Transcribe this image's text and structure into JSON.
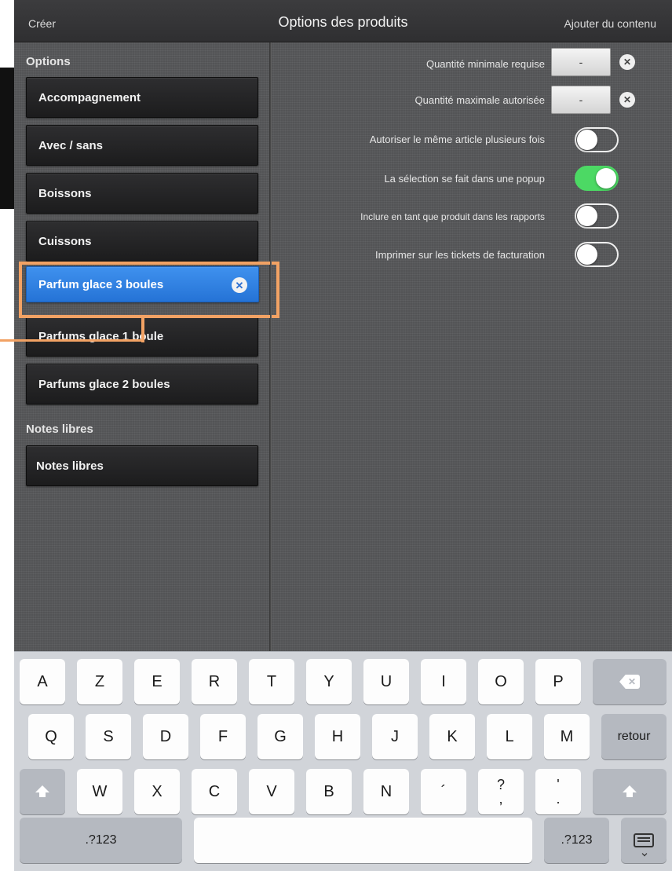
{
  "topbar": {
    "left_action": "Créer",
    "title": "Options des produits",
    "right_action": "Ajouter du contenu"
  },
  "sidebar": {
    "options_header": "Options",
    "options": [
      {
        "label": "Accompagnement",
        "selected": false
      },
      {
        "label": "Avec / sans",
        "selected": false
      },
      {
        "label": "Boissons",
        "selected": false
      },
      {
        "label": "Cuissons",
        "selected": false
      },
      {
        "label": "Parfum glace 3 boules",
        "selected": true
      },
      {
        "label": "Parfums glace 1 boule",
        "selected": false
      },
      {
        "label": "Parfums glace 2 boules",
        "selected": false
      }
    ],
    "notes_header": "Notes libres",
    "notes": [
      {
        "label": "Notes libres",
        "selected": false
      }
    ]
  },
  "settings": {
    "min_qty_label": "Quantité minimale requise",
    "min_qty_value": "-",
    "max_qty_label": "Quantité maximale autorisée",
    "max_qty_value": "-",
    "toggles": [
      {
        "label": "Autoriser le même article plusieurs fois",
        "on": false
      },
      {
        "label": "La sélection se fait dans une popup",
        "on": true
      },
      {
        "label": "Inclure en tant que produit dans les rapports",
        "on": false
      },
      {
        "label": "Imprimer sur les tickets de facturation",
        "on": false
      }
    ]
  },
  "keyboard": {
    "row1": [
      "A",
      "Z",
      "E",
      "R",
      "T",
      "Y",
      "U",
      "I",
      "O",
      "P"
    ],
    "row2": [
      "Q",
      "S",
      "D",
      "F",
      "G",
      "H",
      "J",
      "K",
      "L",
      "M"
    ],
    "return_label": "retour",
    "row3": [
      "W",
      "X",
      "C",
      "V",
      "B",
      "N"
    ],
    "punct1": "´",
    "punct2_top": "?",
    "punct2_bottom": ",",
    "punct3_top": "'",
    "punct3_bottom": ".",
    "numbers_left": ".?123",
    "numbers_right": ".?123"
  }
}
